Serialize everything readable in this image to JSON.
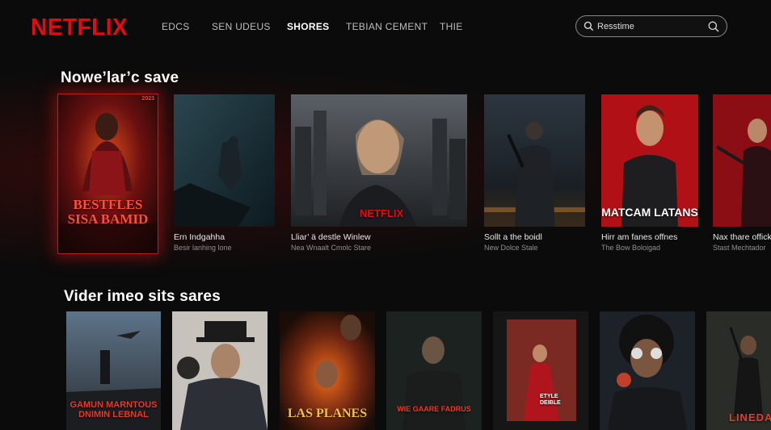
{
  "app": {
    "logo": "NETFLIX",
    "brand_color": "#e50914"
  },
  "nav": {
    "items": [
      {
        "label": "EDCS",
        "active": false
      },
      {
        "label": "SEN UDEUS",
        "active": false
      },
      {
        "label": "SHORES",
        "active": true
      },
      {
        "label": "TEBIAN CEMENT",
        "active": false
      },
      {
        "label": "THIE",
        "active": false
      }
    ]
  },
  "search": {
    "value": "Resstime",
    "icon_left": "search-icon",
    "icon_right": "search-icon"
  },
  "rows": [
    {
      "title": "Nowe’lar’c save",
      "items": [
        {
          "poster_text": "BESTFLES\nSISA BAMID",
          "badge": "2023",
          "caption": "",
          "title": "",
          "subtitle": "",
          "featured": true
        },
        {
          "poster_text": "",
          "title": "Ern Indgahha",
          "subtitle": "Besir lanhing lone"
        },
        {
          "poster_text": "NETFLIX",
          "title": "Lliar’ ä destle Winlew",
          "subtitle": "Nea Wnaalt Cmolc Stare"
        },
        {
          "poster_text": "",
          "title": "Sollt a the boidl",
          "subtitle": "New Dolce Stale"
        },
        {
          "poster_text": "MATCAM LATANS",
          "title": "Hirr am fanes offnes",
          "subtitle": "The Bow Boloigad"
        },
        {
          "poster_text": "",
          "title": "Nax thare offickl",
          "subtitle": "Stast Mechtador"
        }
      ]
    },
    {
      "title": "Vider imeo sits sares",
      "items": [
        {
          "poster_text": "GAMUN MARNTOUS\nDNIMIN LEBNAL"
        },
        {
          "poster_text": ""
        },
        {
          "poster_text": "LAS PLANES"
        },
        {
          "poster_text": "WIE GAARE FADRUS"
        },
        {
          "poster_text": "ETYLE\nDEIBLE"
        },
        {
          "poster_text": ""
        },
        {
          "poster_text": "LINEDA"
        }
      ]
    }
  ]
}
